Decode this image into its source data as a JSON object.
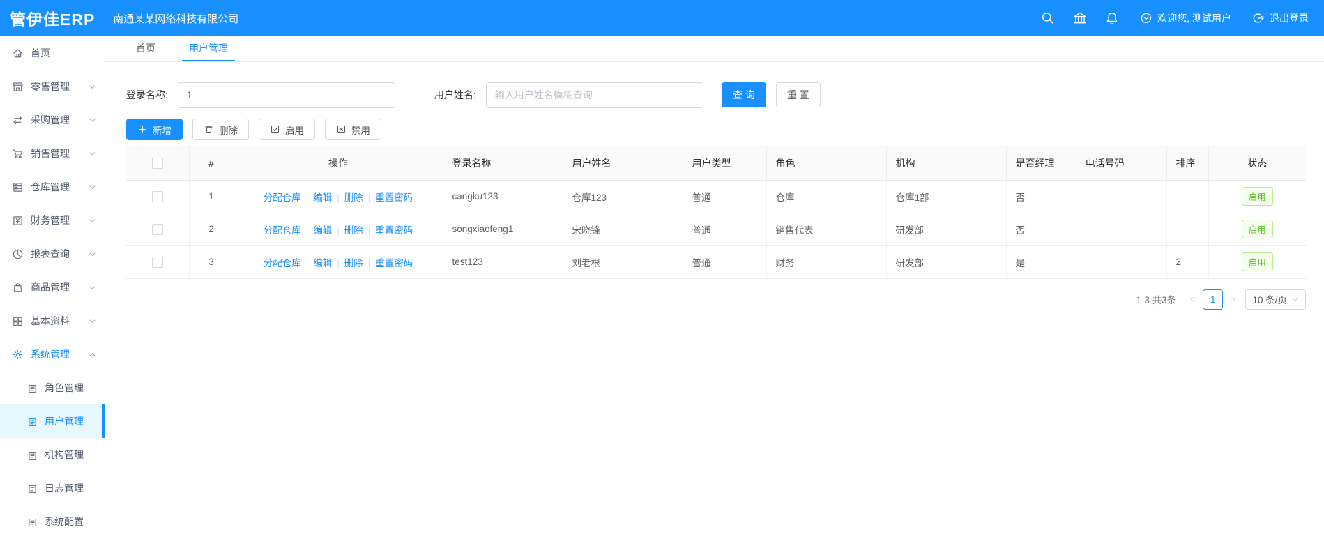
{
  "header": {
    "logo": "管伊佳ERP",
    "company": "南通某某网络科技有限公司",
    "welcome": "欢迎您, 测试用户",
    "logout": "退出登录"
  },
  "sidebar": {
    "items": [
      {
        "label": "首页",
        "icon": "home"
      },
      {
        "label": "零售管理",
        "icon": "shop",
        "chevron": "down"
      },
      {
        "label": "采购管理",
        "icon": "exchange",
        "chevron": "down"
      },
      {
        "label": "销售管理",
        "icon": "cart",
        "chevron": "down"
      },
      {
        "label": "仓库管理",
        "icon": "warehouse",
        "chevron": "down"
      },
      {
        "label": "财务管理",
        "icon": "finance",
        "chevron": "down"
      },
      {
        "label": "报表查询",
        "icon": "report",
        "chevron": "down"
      },
      {
        "label": "商品管理",
        "icon": "goods",
        "chevron": "down"
      },
      {
        "label": "基本资料",
        "icon": "basic",
        "chevron": "down"
      },
      {
        "label": "系统管理",
        "icon": "gear",
        "chevron": "up",
        "parent_active": true
      },
      {
        "label": "角色管理",
        "icon": "doc",
        "sub": true
      },
      {
        "label": "用户管理",
        "icon": "doc",
        "sub": true,
        "active": true
      },
      {
        "label": "机构管理",
        "icon": "doc",
        "sub": true
      },
      {
        "label": "日志管理",
        "icon": "doc",
        "sub": true
      },
      {
        "label": "系统配置",
        "icon": "doc",
        "sub": true
      }
    ]
  },
  "tabs": [
    {
      "label": "首页"
    },
    {
      "label": "用户管理",
      "active": true
    }
  ],
  "search": {
    "login_label": "登录名称:",
    "login_value": "1",
    "name_label": "用户姓名:",
    "name_placeholder": "输入用户姓名模糊查询",
    "query": "查 询",
    "reset": "重 置"
  },
  "toolbar": {
    "add": "新增",
    "delete": "删除",
    "enable": "启用",
    "disable": "禁用"
  },
  "table": {
    "columns": [
      "#",
      "操作",
      "登录名称",
      "用户姓名",
      "用户类型",
      "角色",
      "机构",
      "是否经理",
      "电话号码",
      "排序",
      "状态"
    ],
    "op_links": [
      "分配仓库",
      "编辑",
      "删除",
      "重置密码"
    ],
    "rows": [
      {
        "index": "1",
        "login": "cangku123",
        "name": "仓库123",
        "type": "普通",
        "role": "仓库",
        "org": "仓库1部",
        "manager": "否",
        "phone": "",
        "sort": "",
        "status": "启用"
      },
      {
        "index": "2",
        "login": "songxiaofeng1",
        "name": "宋晓锋",
        "type": "普通",
        "role": "销售代表",
        "org": "研发部",
        "manager": "否",
        "phone": "",
        "sort": "",
        "status": "启用"
      },
      {
        "index": "3",
        "login": "test123",
        "name": "刘老根",
        "type": "普通",
        "role": "财务",
        "org": "研发部",
        "manager": "是",
        "phone": "",
        "sort": "2",
        "status": "启用"
      }
    ]
  },
  "pagination": {
    "total": "1-3 共3条",
    "prev": "<",
    "page": "1",
    "next": ">",
    "page_size": "10 条/页"
  },
  "colors": {
    "primary": "#1890ff",
    "success_text": "#52c41a",
    "success_bg": "#f6ffed",
    "success_border": "#b7eb8f"
  }
}
